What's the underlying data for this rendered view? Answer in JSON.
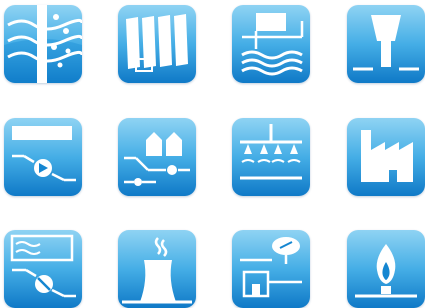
{
  "theme": {
    "tile_top": "#8fd3f3",
    "tile_bottom": "#0f79c7",
    "glyph": "#ffffff"
  },
  "icons": [
    {
      "name": "filter-column-wave-icon"
    },
    {
      "name": "filter-panels-icon"
    },
    {
      "name": "sedimentation-tank-icon"
    },
    {
      "name": "cooling-tower-icon"
    },
    {
      "name": "tank-pump-icon"
    },
    {
      "name": "silo-valve-icon"
    },
    {
      "name": "sprinkler-icon"
    },
    {
      "name": "factory-icon"
    },
    {
      "name": "tank-heat-pump-icon"
    },
    {
      "name": "power-plant-icon"
    },
    {
      "name": "valve-building-icon"
    },
    {
      "name": "gas-burner-icon"
    }
  ]
}
